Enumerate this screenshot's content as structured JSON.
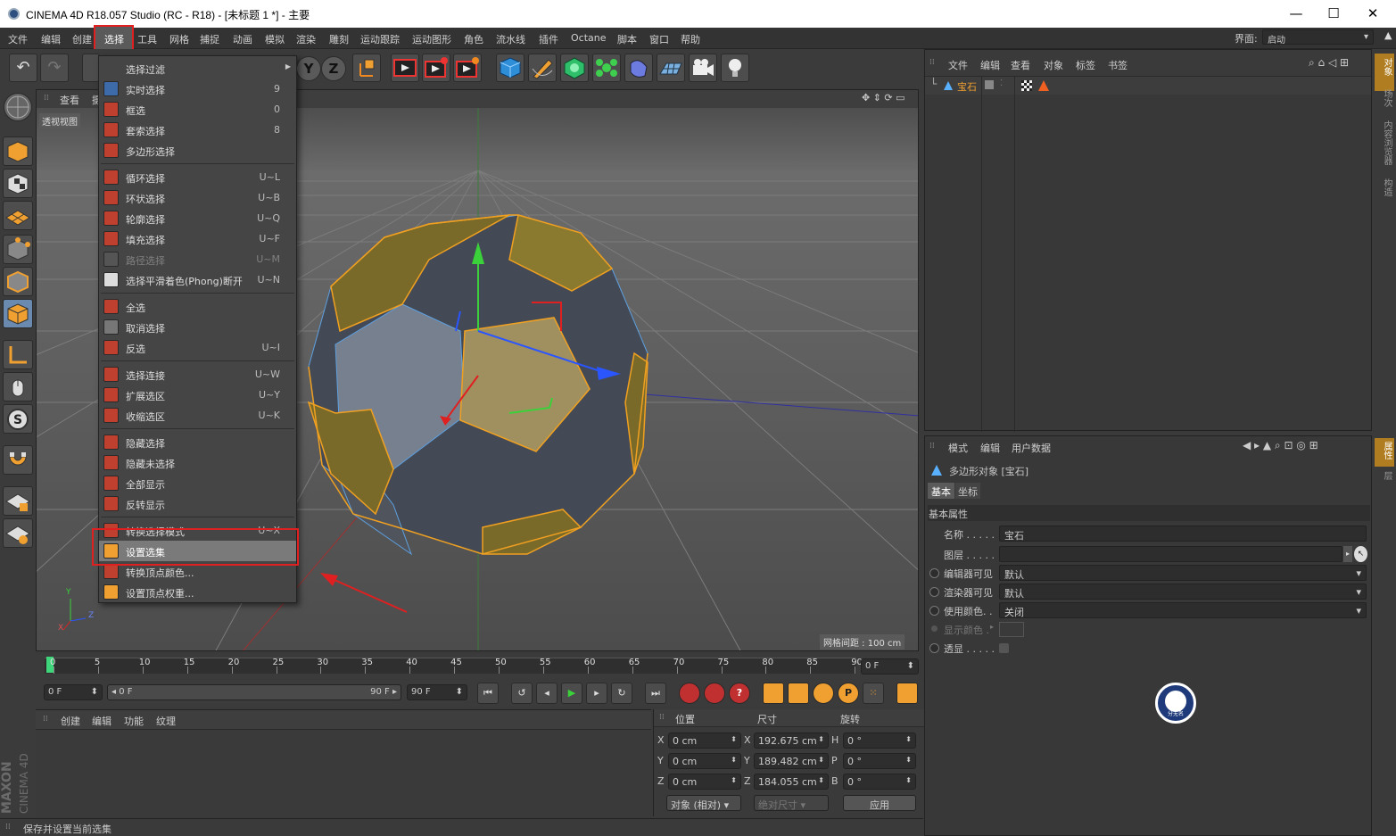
{
  "window": {
    "title": "CINEMA 4D R18.057 Studio (RC - R18) - [未标题 1 *] - 主要"
  },
  "menubar": {
    "items": [
      "文件",
      "编辑",
      "创建",
      "选择",
      "工具",
      "网格",
      "捕捉",
      "动画",
      "模拟",
      "渲染",
      "雕刻",
      "运动跟踪",
      "运动图形",
      "角色",
      "流水线",
      "插件",
      "Octane",
      "脚本",
      "窗口",
      "帮助"
    ],
    "layout_label": "界面:",
    "layout_value": "启动"
  },
  "viewport": {
    "menu": [
      "查看",
      "摄"
    ],
    "name": "透视视图",
    "grid_spacing": "网格间距 : 100 cm",
    "axis": {
      "y": "Y",
      "z": "Z",
      "x": "X"
    }
  },
  "select_menu": {
    "groups": [
      [
        {
          "label": "选择过滤",
          "shortcut": "",
          "icon": "none",
          "submenu": true
        },
        {
          "label": "实时选择",
          "shortcut": "9",
          "icon": "live-select-icon"
        },
        {
          "label": "框选",
          "shortcut": "0",
          "icon": "rect-select-icon"
        },
        {
          "label": "套索选择",
          "shortcut": "8",
          "icon": "lasso-select-icon"
        },
        {
          "label": "多边形选择",
          "shortcut": "",
          "icon": "polygon-select-icon"
        }
      ],
      [
        {
          "label": "循环选择",
          "shortcut": "U~L",
          "icon": "loop-select-icon"
        },
        {
          "label": "环状选择",
          "shortcut": "U~B",
          "icon": "ring-select-icon"
        },
        {
          "label": "轮廓选择",
          "shortcut": "U~Q",
          "icon": "outline-select-icon"
        },
        {
          "label": "填充选择",
          "shortcut": "U~F",
          "icon": "fill-select-icon"
        },
        {
          "label": "路径选择",
          "shortcut": "U~M",
          "icon": "path-select-icon",
          "disabled": true
        },
        {
          "label": "选择平滑着色(Phong)断开",
          "shortcut": "U~N",
          "icon": "phong-break-icon"
        }
      ],
      [
        {
          "label": "全选",
          "shortcut": "",
          "icon": "select-all-icon"
        },
        {
          "label": "取消选择",
          "shortcut": "",
          "icon": "deselect-icon"
        },
        {
          "label": "反选",
          "shortcut": "U~I",
          "icon": "invert-select-icon"
        }
      ],
      [
        {
          "label": "选择连接",
          "shortcut": "U~W",
          "icon": "select-connected-icon"
        },
        {
          "label": "扩展选区",
          "shortcut": "U~Y",
          "icon": "grow-select-icon"
        },
        {
          "label": "收缩选区",
          "shortcut": "U~K",
          "icon": "shrink-select-icon"
        }
      ],
      [
        {
          "label": "隐藏选择",
          "shortcut": "",
          "icon": "hide-selected-icon"
        },
        {
          "label": "隐藏未选择",
          "shortcut": "",
          "icon": "hide-unselected-icon"
        },
        {
          "label": "全部显示",
          "shortcut": "",
          "icon": "unhide-all-icon"
        },
        {
          "label": "反转显示",
          "shortcut": "",
          "icon": "invert-visibility-icon"
        }
      ],
      [
        {
          "label": "转换选择模式",
          "shortcut": "U~X",
          "icon": "convert-selection-icon"
        },
        {
          "label": "设置选集",
          "shortcut": "",
          "icon": "set-selection-icon",
          "highlight": true
        },
        {
          "label": "转换顶点颜色...",
          "shortcut": "",
          "icon": "vertex-color-icon"
        },
        {
          "label": "设置顶点权重...",
          "shortcut": "",
          "icon": "vertex-weight-icon"
        }
      ]
    ]
  },
  "timeline": {
    "ticks": [
      "0",
      "5",
      "10",
      "15",
      "20",
      "25",
      "30",
      "35",
      "40",
      "45",
      "50",
      "55",
      "60",
      "65",
      "70",
      "75",
      "80",
      "85",
      "90"
    ],
    "current": "0 F"
  },
  "transport": {
    "start": "0 F",
    "range_start": "0 F",
    "range_end": "90 F",
    "end": "90 F"
  },
  "material_panel": {
    "menu": [
      "创建",
      "编辑",
      "功能",
      "纹理"
    ]
  },
  "coords": {
    "headers": [
      "位置",
      "尺寸",
      "旋转"
    ],
    "rows": [
      {
        "a": "X",
        "pos": "0 cm",
        "b": "X",
        "size": "192.675 cm",
        "c": "H",
        "rot": "0 °"
      },
      {
        "a": "Y",
        "pos": "0 cm",
        "b": "Y",
        "size": "189.482 cm",
        "c": "P",
        "rot": "0 °"
      },
      {
        "a": "Z",
        "pos": "0 cm",
        "b": "Z",
        "size": "184.055 cm",
        "c": "B",
        "rot": "0 °"
      }
    ],
    "mode": "对象 (相对)",
    "size_mode": "绝对尺寸",
    "apply": "应用"
  },
  "status": {
    "text": "保存并设置当前选集"
  },
  "object_manager": {
    "menu": [
      "文件",
      "编辑",
      "查看",
      "对象",
      "标签",
      "书签"
    ],
    "object_name": "宝石"
  },
  "attribute_manager": {
    "menu": [
      "模式",
      "编辑",
      "用户数据"
    ],
    "object_title": "多边形对象 [宝石]",
    "tabs": [
      "基本",
      "坐标"
    ],
    "section": "基本属性",
    "name_label": "名称 . . . . .",
    "name_value": "宝石",
    "layer_label": "图层 . . . . .",
    "editor_label": "编辑器可见",
    "editor_value": "默认",
    "render_label": "渲染器可见",
    "render_value": "默认",
    "color_label": "使用颜色. .",
    "color_value": "关闭",
    "display_color_label": "显示颜色 .",
    "xray_label": "透显 . . . . ."
  },
  "right_tabs": [
    "对象",
    "场次",
    "内容浏览器",
    "构造"
  ],
  "right_tabs2": [
    "属性",
    "层"
  ],
  "brand": {
    "maxon": "MAXON",
    "c4d": "CINEMA 4D"
  },
  "watermark": "分无名"
}
